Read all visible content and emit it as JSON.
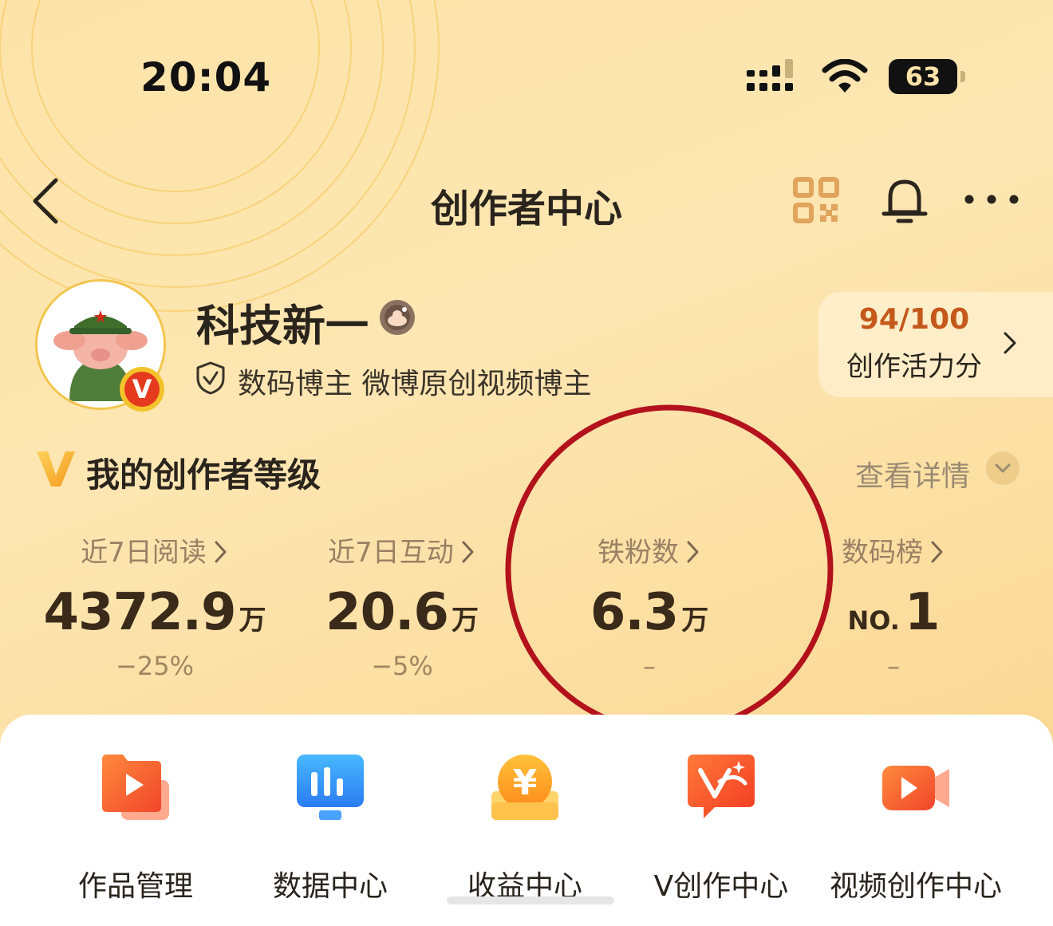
{
  "status_bar": {
    "time": "20:04",
    "battery": "63",
    "icons": [
      "signal-icon",
      "wifi-icon",
      "battery-icon"
    ]
  },
  "nav": {
    "title": "创作者中心",
    "icons": [
      "back-icon",
      "qr-code-icon",
      "bell-icon",
      "more-icon"
    ]
  },
  "profile": {
    "name": "科技新一",
    "badge_letter": "V",
    "verification": "数码博主 微博原创视频博主",
    "vitality_score": "94/100",
    "vitality_label": "创作活力分"
  },
  "level": {
    "title": "我的创作者等级",
    "detail_link": "查看详情"
  },
  "stats": [
    {
      "label": "近7日阅读",
      "value": "4372.9",
      "unit": "万",
      "change": "−25%"
    },
    {
      "label": "近7日互动",
      "value": "20.6",
      "unit": "万",
      "change": "−5%"
    },
    {
      "label": "铁粉数",
      "value": "6.3",
      "unit": "万",
      "change": "–"
    },
    {
      "label": "数码榜",
      "prefix": "NO.",
      "value": "1",
      "change": "–"
    }
  ],
  "tools": [
    {
      "label": "作品管理",
      "icon": "works-management-icon"
    },
    {
      "label": "数据中心",
      "icon": "data-center-icon"
    },
    {
      "label": "收益中心",
      "icon": "earnings-center-icon"
    },
    {
      "label": "V创作中心",
      "icon": "v-creation-icon"
    },
    {
      "label": "视频创作中心",
      "icon": "video-creation-icon"
    }
  ],
  "colors": {
    "accent": "#c4591b",
    "highlight_circle": "#b3121c",
    "background": "#fde3a8"
  }
}
